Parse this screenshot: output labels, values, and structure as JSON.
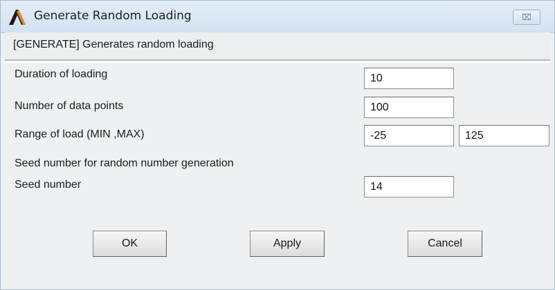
{
  "window": {
    "title": "Generate Random Loading",
    "close_symbol": "⌧"
  },
  "description": "[GENERATE] Generates random loading",
  "fields": {
    "duration": {
      "label": "Duration of loading",
      "value": "10"
    },
    "data_points": {
      "label": "Number of data points",
      "value": "100"
    },
    "load_range": {
      "label": "Range of load (MIN ,MAX)",
      "min_value": "-25",
      "max_value": "125"
    },
    "seed_heading": "Seed number for random number generation",
    "seed": {
      "label": "Seed number",
      "value": "14"
    }
  },
  "buttons": {
    "ok": "OK",
    "apply": "Apply",
    "cancel": "Cancel"
  },
  "colors": {
    "titlebar": "#d8e5f3",
    "dialog_bg": "#eef0f2",
    "app_icon": "#1a1a1a",
    "app_icon_accent": "#e08a1e"
  },
  "icons": {
    "app": "ansys-lambda-icon",
    "close": "close-icon"
  }
}
